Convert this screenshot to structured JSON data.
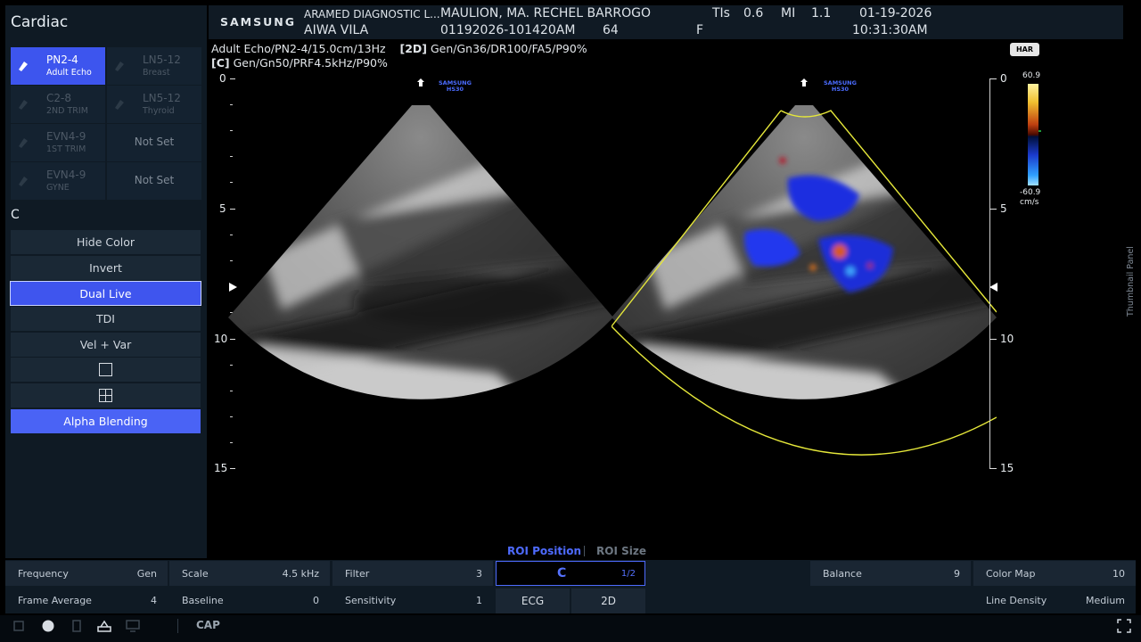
{
  "app": {
    "title": "Cardiac"
  },
  "probes": [
    {
      "name": "PN2-4",
      "preset": "Adult Echo",
      "active": true
    },
    {
      "name": "LN5-12",
      "preset": "Breast",
      "active": false
    },
    {
      "name": "C2-8",
      "preset": "2ND TRIM",
      "active": false
    },
    {
      "name": "LN5-12",
      "preset": "Thyroid",
      "active": false
    },
    {
      "name": "EVN4-9",
      "preset": "1ST TRIM",
      "active": false
    },
    {
      "name": "",
      "preset": "Not Set",
      "active": false
    },
    {
      "name": "EVN4-9",
      "preset": "GYNE",
      "active": false
    },
    {
      "name": "",
      "preset": "Not Set",
      "active": false
    }
  ],
  "mode_label": "C",
  "mode_buttons": {
    "hide_color": "Hide Color",
    "invert": "Invert",
    "dual_live": "Dual Live",
    "tdi": "TDI",
    "vel_var": "Vel + Var",
    "alpha_blending": "Alpha Blending"
  },
  "header": {
    "brand": "SAMSUNG",
    "institution": "ARAMED DIAGNOSTIC L...",
    "operator": "AIWA VILA",
    "patient_name": "MAULION, MA. RECHEL BARROGO",
    "study_id": "01192026-101420AM",
    "age": "64",
    "sex": "F",
    "tis_label": "TIs",
    "tis_value": "0.6",
    "mi_label": "MI",
    "mi_value": "1.1",
    "date": "01-19-2026",
    "time": "10:31:30AM"
  },
  "image_info": {
    "line1": "Adult Echo/PN2-4/15.0cm/13Hz",
    "line1_2d_tag": "[2D]",
    "line1_2d": "Gen/Gn36/DR100/FA5/P90%",
    "line2_tag": "[C]",
    "line2": "Gen/Gn50/PRF4.5kHz/P90%"
  },
  "depth_labels": [
    "0",
    "5",
    "10",
    "15"
  ],
  "device_label": {
    "brand": "SAMSUNG",
    "model": "HS30"
  },
  "color_bar": {
    "max": "60.9",
    "min": "-60.9",
    "unit": "cm/s"
  },
  "har_badge": "HAR",
  "roi_tabs": {
    "position": "ROI Position",
    "size": "ROI Size"
  },
  "controls": {
    "frequency": {
      "label": "Frequency",
      "value": "Gen"
    },
    "scale": {
      "label": "Scale",
      "value": "4.5 kHz"
    },
    "filter": {
      "label": "Filter",
      "value": "3"
    },
    "mode": {
      "label": "C",
      "page": "1/2"
    },
    "balance": {
      "label": "Balance",
      "value": "9"
    },
    "color_map": {
      "label": "Color Map",
      "value": "10"
    },
    "frame_average": {
      "label": "Frame Average",
      "value": "4"
    },
    "baseline": {
      "label": "Baseline",
      "value": "0"
    },
    "sensitivity": {
      "label": "Sensitivity",
      "value": "1"
    },
    "ecg": "ECG",
    "two_d": "2D",
    "line_density": {
      "label": "Line Density",
      "value": "Medium"
    }
  },
  "thumbnail_panel": "Thumbnail Panel",
  "bottom_bar": {
    "cap": "CAP"
  },
  "colors": {
    "accent": "#4a63f5",
    "roi": "#e6e83a",
    "panel": "#1a2633"
  }
}
